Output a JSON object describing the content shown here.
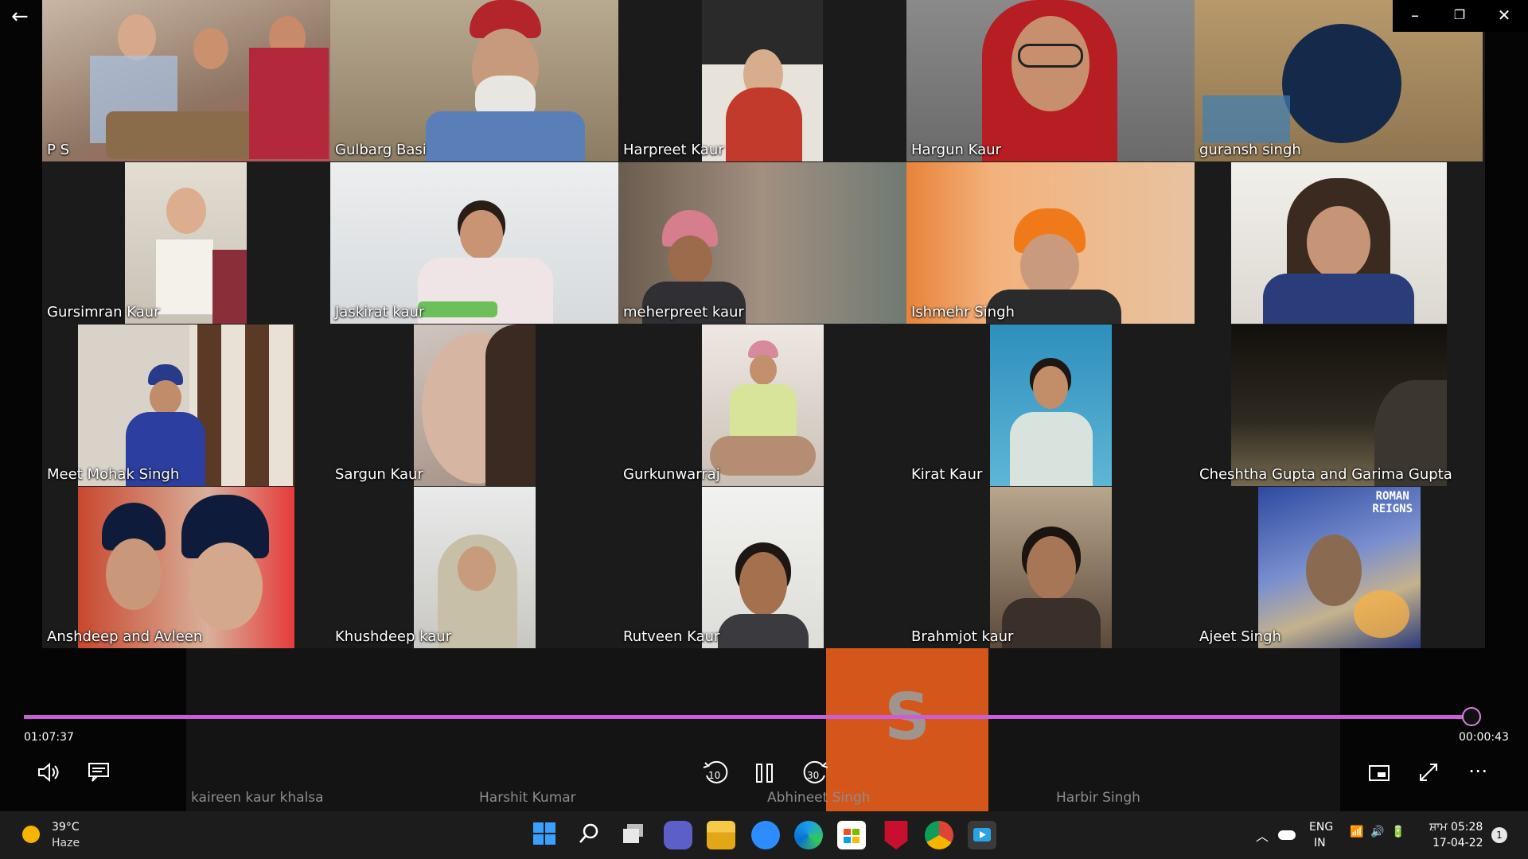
{
  "participants": [
    {
      "name": "P S"
    },
    {
      "name": "Gulbarg Basi"
    },
    {
      "name": "Harpreet Kaur"
    },
    {
      "name": "Hargun Kaur"
    },
    {
      "name": "guransh singh"
    },
    {
      "name": "Gursimran Kaur"
    },
    {
      "name": "Jaskirat kaur"
    },
    {
      "name": "meherpreet kaur"
    },
    {
      "name": "Ishmehr Singh"
    },
    {
      "name": ""
    },
    {
      "name": "Meet Mohak Singh"
    },
    {
      "name": "Sargun Kaur"
    },
    {
      "name": "Gurkunwarraj"
    },
    {
      "name": "Kirat Kaur"
    },
    {
      "name": "Cheshtha Gupta and Garima Gupta"
    },
    {
      "name": "Anshdeep and Avleen"
    },
    {
      "name": "Khushdeep kaur"
    },
    {
      "name": "Rutveen Kaur"
    },
    {
      "name": "Brahmjot kaur"
    },
    {
      "name": "Ajeet Singh"
    }
  ],
  "bottom_row": {
    "names": [
      "kaireen kaur khalsa",
      "Harshit Kumar",
      "Abhineet Singh",
      "Harbir Singh"
    ],
    "avatar_letter": "S",
    "avatar_color": "#d5561b"
  },
  "poster": {
    "line1": "ROMAN",
    "line2": "REIGNS"
  },
  "player": {
    "elapsed": "01:07:37",
    "remaining": "00:00:43",
    "progress": 0.994,
    "accent": "#c95fd7",
    "skip_back": "10",
    "skip_forward": "30"
  },
  "icons": {
    "back": "back-arrow-icon",
    "volume": "volume-icon",
    "captions": "captions-icon",
    "rewind": "rewind-10-icon",
    "pause": "pause-icon",
    "forward": "forward-30-icon",
    "miniplayer": "miniplayer-icon",
    "fullscreen": "fullscreen-icon",
    "more": "more-icon"
  },
  "taskbar": {
    "weather_temp": "39°C",
    "weather_desc": "Haze",
    "lang_top": "ENG",
    "lang_bottom": "IN",
    "clock_time": "ਸ਼ਾਮ 05:28",
    "clock_date": "17-04-22",
    "notification_count": "1"
  }
}
